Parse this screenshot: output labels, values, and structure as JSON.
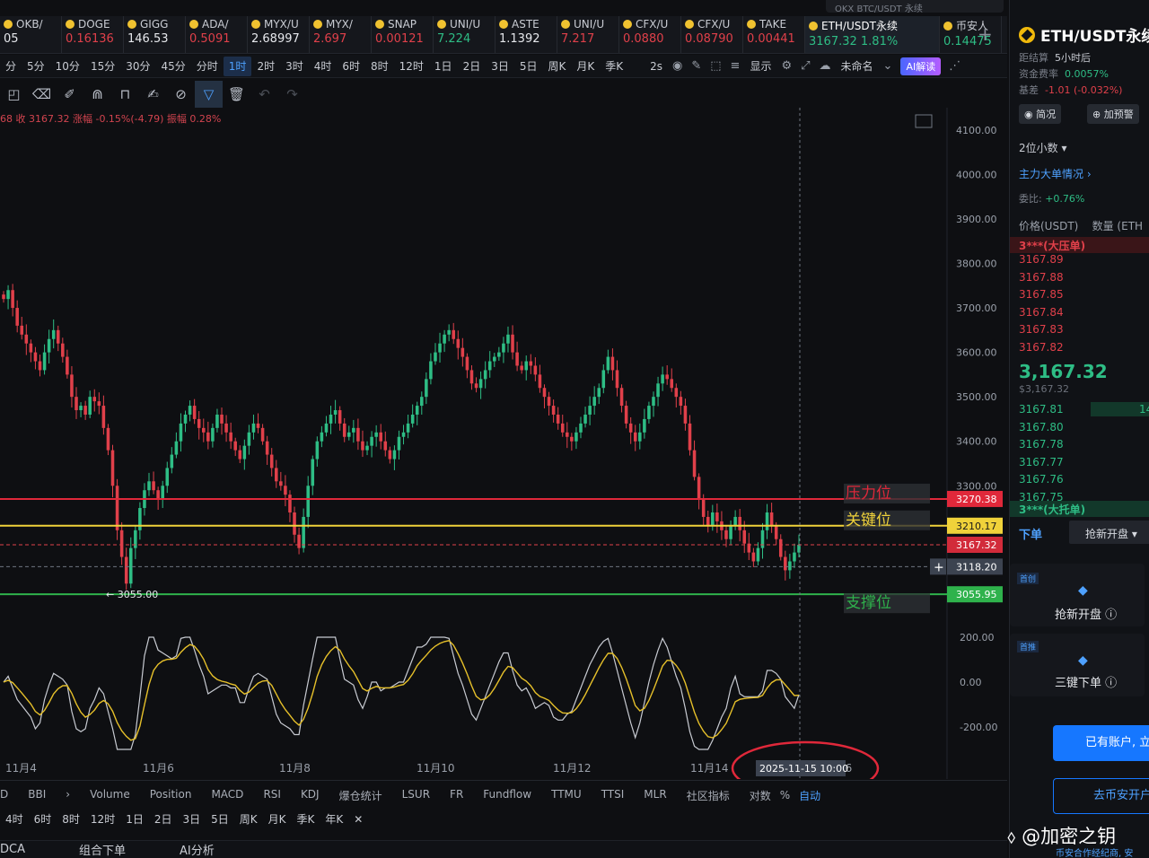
{
  "top_search": "OKX BTC/USDT 永续",
  "tickers": [
    {
      "name": "OKB/",
      "price": "05",
      "dir": "wh"
    },
    {
      "name": "DOGE",
      "price": "0.16136",
      "dir": "dn"
    },
    {
      "name": "GIGG",
      "price": "146.53",
      "dir": "wh"
    },
    {
      "name": "ADA/",
      "price": "0.5091",
      "dir": "dn"
    },
    {
      "name": "MYX/U",
      "price": "2.68997",
      "dir": "wh"
    },
    {
      "name": "MYX/",
      "price": "2.697",
      "dir": "dn"
    },
    {
      "name": "SNAP",
      "price": "0.00121",
      "dir": "dn"
    },
    {
      "name": "UNI/U",
      "price": "7.224",
      "dir": "up"
    },
    {
      "name": "ASTE",
      "price": "1.1392",
      "dir": "wh"
    },
    {
      "name": "UNI/U",
      "price": "7.217",
      "dir": "dn"
    },
    {
      "name": "CFX/U",
      "price": "0.0880",
      "dir": "dn"
    },
    {
      "name": "CFX/U",
      "price": "0.08790",
      "dir": "dn"
    },
    {
      "name": "TAKE",
      "price": "0.00441",
      "dir": "dn"
    },
    {
      "name": "ETH/USDT永续",
      "price": "3167.32  1.81%",
      "dir": "up",
      "active": true
    },
    {
      "name": "币安人",
      "price": "0.14475",
      "dir": "up"
    }
  ],
  "intervals": [
    "分",
    "5分",
    "10分",
    "15分",
    "30分",
    "45分",
    "分时",
    "1时",
    "2时",
    "3时",
    "4时",
    "6时",
    "8时",
    "12时",
    "1日",
    "2日",
    "3日",
    "5日",
    "周K",
    "月K",
    "季K"
  ],
  "selected_interval": "1时",
  "toolbar_right": {
    "sec": "2s",
    "display": "显示",
    "unnamed": "未命名",
    "ai": "AI解读"
  },
  "ohlc_text": "68 收 3167.32 涨幅 -0.15%(-4.79) 振幅 0.28%",
  "chart_data": {
    "type": "candlestick",
    "title": "ETH/USDT永续",
    "x_labels": [
      "11月4",
      "11月6",
      "11月8",
      "11月10",
      "11月12",
      "11月14",
      "16"
    ],
    "y_ticks": [
      4100,
      4000,
      3900,
      3800,
      3700,
      3600,
      3500,
      3400,
      3300
    ],
    "ylim": [
      3020,
      4130
    ],
    "close_series": [
      3720,
      3740,
      3700,
      3660,
      3640,
      3620,
      3600,
      3580,
      3560,
      3600,
      3630,
      3650,
      3620,
      3590,
      3550,
      3500,
      3470,
      3480,
      3460,
      3500,
      3490,
      3480,
      3430,
      3380,
      3300,
      3200,
      3140,
      3080,
      3160,
      3200,
      3250,
      3290,
      3310,
      3290,
      3270,
      3300,
      3340,
      3370,
      3400,
      3440,
      3460,
      3480,
      3450,
      3430,
      3420,
      3400,
      3430,
      3460,
      3440,
      3420,
      3400,
      3380,
      3360,
      3390,
      3420,
      3440,
      3430,
      3400,
      3370,
      3340,
      3310,
      3300,
      3280,
      3240,
      3190,
      3160,
      3230,
      3300,
      3360,
      3400,
      3420,
      3440,
      3460,
      3470,
      3440,
      3410,
      3420,
      3430,
      3400,
      3380,
      3390,
      3410,
      3420,
      3400,
      3380,
      3360,
      3380,
      3410,
      3420,
      3440,
      3460,
      3480,
      3500,
      3540,
      3580,
      3600,
      3620,
      3640,
      3650,
      3630,
      3610,
      3590,
      3560,
      3530,
      3520,
      3540,
      3560,
      3580,
      3590,
      3600,
      3620,
      3640,
      3600,
      3570,
      3560,
      3580,
      3570,
      3550,
      3520,
      3500,
      3480,
      3460,
      3440,
      3420,
      3410,
      3400,
      3420,
      3440,
      3460,
      3480,
      3500,
      3520,
      3560,
      3590,
      3560,
      3520,
      3480,
      3440,
      3420,
      3400,
      3420,
      3450,
      3480,
      3500,
      3530,
      3550,
      3540,
      3520,
      3500,
      3480,
      3440,
      3380,
      3320,
      3270,
      3230,
      3210,
      3240,
      3220,
      3200,
      3180,
      3210,
      3230,
      3200,
      3170,
      3150,
      3130,
      3160,
      3200,
      3240,
      3210,
      3180,
      3140,
      3110,
      3130,
      3150,
      3167.32
    ],
    "levels": [
      {
        "name": "压力位",
        "value": 3270.38,
        "label": "3270.38",
        "color": "#e0283a"
      },
      {
        "name": "关键位",
        "value": 3210.17,
        "label": "3210.17",
        "color": "#f0d23a"
      },
      {
        "name": "current",
        "value": 3167.32,
        "label": "3167.32",
        "color": "#e0404a"
      },
      {
        "name": "crosshair",
        "value": 3118.2,
        "label": "3118.20",
        "color": "#6f7580"
      },
      {
        "name": "支撑位",
        "value": 3055.95,
        "label": "3055.95",
        "color": "#2fb24c"
      }
    ],
    "low_marker": "← 3055.00",
    "oscillator": {
      "y_ticks": [
        "200.00",
        "0.00",
        "-200.00"
      ],
      "ylim": [
        -320,
        240
      ]
    },
    "crosshair_time": "2025-11-15 10:00"
  },
  "indicators": [
    "D",
    "BBI",
    "Volume",
    "Position",
    "MACD",
    "RSI",
    "KDJ",
    "爆仓统计",
    "LSUR",
    "FR",
    "Fundflow",
    "TTMU",
    "TTSI",
    "MLR"
  ],
  "indicators_right": {
    "community": "社区指标",
    "pair": "对数",
    "pct": "%",
    "auto": "自动"
  },
  "bottom_intervals": [
    "4时",
    "6时",
    "8时",
    "12时",
    "1日",
    "2日",
    "3日",
    "5日",
    "周K",
    "月K",
    "季K",
    "年K"
  ],
  "bottom_tabs": [
    "DCA",
    "组合下单",
    "AI分析"
  ],
  "right_panel": {
    "pair": "ETH/USDT永续",
    "settle_label": "距结算",
    "settle_value": "5小时后",
    "funding_label": "资金费率",
    "funding_value": "0.0057%",
    "basis_label": "基差",
    "basis_value": "-1.01 (-0.032%)",
    "btn_overview": "简况",
    "btn_alert": "加预警",
    "decimals": "2位小数",
    "big_orders": "主力大单情况",
    "ratio_label": "委比:",
    "ratio_value": "+0.76%",
    "col_price": "价格(USDT)",
    "col_qty": "数量 (ETH",
    "ask_banner": "3***(大压单)",
    "asks": [
      "3167.89",
      "3167.88",
      "3167.85",
      "3167.84",
      "3167.83",
      "3167.82"
    ],
    "last_price": "3,167.32",
    "last_price_sub": "$3,167.32",
    "bids": [
      "3167.81",
      "3167.80",
      "3167.78",
      "3167.77",
      "3167.76",
      "3167.75"
    ],
    "bid_qty": "14",
    "bid_banner": "3***(大托单)",
    "tab_order": "下单",
    "tab_grab": "抢新开盘",
    "feat1_tag": "首创",
    "feat1": "抢新开盘",
    "feat2_tag": "首推",
    "feat2": "三键下单",
    "has_account": "已有账户, 立",
    "go_binance": "去币安开户",
    "watermark": "@加密之钥",
    "watermark_sub": "币安合作经纪商, 安"
  }
}
